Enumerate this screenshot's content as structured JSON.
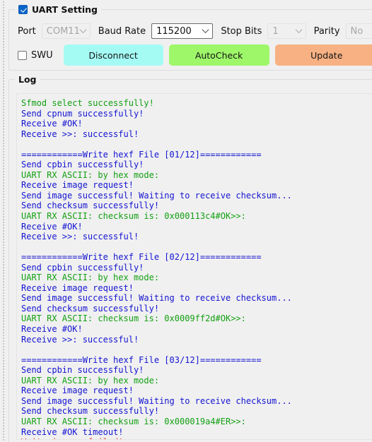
{
  "uart_group": {
    "title": "UART Setting",
    "enabled_checkbox": "checked",
    "port": {
      "label": "Port",
      "value": "COM11",
      "enabled": false
    },
    "baud_rate": {
      "label": "Baud Rate",
      "value": "115200",
      "enabled": true
    },
    "stop_bits": {
      "label": "Stop Bits",
      "value": "1",
      "enabled": false
    },
    "parity": {
      "label": "Parity",
      "value": "No",
      "enabled": false
    },
    "swu": {
      "label": "SWU",
      "checked": false
    },
    "buttons": [
      {
        "label": "Disconnect",
        "color": "#a4fbf4"
      },
      {
        "label": "AutoCheck",
        "color": "#9ef769"
      },
      {
        "label": "Update",
        "color": "#f7b183"
      }
    ]
  },
  "log_group": {
    "title": "Log",
    "lines": [
      {
        "text": "Sfmod select successfully!",
        "color": "green"
      },
      {
        "text": "Send cpnum successfully!",
        "color": "blue"
      },
      {
        "text": "Receive #OK!",
        "color": "blue"
      },
      {
        "text": "Receive >>: successful!",
        "color": "blue"
      },
      {
        "text": "",
        "color": "blank"
      },
      {
        "text": "============Write hexf File [01/12]============",
        "color": "blue"
      },
      {
        "text": "Send cpbin successfully!",
        "color": "blue"
      },
      {
        "text": "UART RX ASCII: by hex mode:",
        "color": "green"
      },
      {
        "text": "Receive image request!",
        "color": "blue"
      },
      {
        "text": "Send image successful! Waiting to receive checksum...",
        "color": "blue"
      },
      {
        "text": "Send checksum successfully!",
        "color": "blue"
      },
      {
        "text": "UART RX ASCII: checksum is: 0x000113c4#OK>>:",
        "color": "green"
      },
      {
        "text": "Receive #OK!",
        "color": "blue"
      },
      {
        "text": "Receive >>: successful!",
        "color": "blue"
      },
      {
        "text": "",
        "color": "blank"
      },
      {
        "text": "============Write hexf File [02/12]============",
        "color": "blue"
      },
      {
        "text": "Send cpbin successfully!",
        "color": "blue"
      },
      {
        "text": "UART RX ASCII: by hex mode:",
        "color": "green"
      },
      {
        "text": "Receive image request!",
        "color": "blue"
      },
      {
        "text": "Send image successful! Waiting to receive checksum...",
        "color": "blue"
      },
      {
        "text": "Send checksum successfully!",
        "color": "blue"
      },
      {
        "text": "UART RX ASCII: checksum is: 0x0009ff2d#OK>>:",
        "color": "green"
      },
      {
        "text": "Receive #OK!",
        "color": "blue"
      },
      {
        "text": "Receive >>: successful!",
        "color": "blue"
      },
      {
        "text": "",
        "color": "blank"
      },
      {
        "text": "============Write hexf File [03/12]============",
        "color": "blue"
      },
      {
        "text": "Send cpbin successfully!",
        "color": "blue"
      },
      {
        "text": "UART RX ASCII: by hex mode:",
        "color": "green"
      },
      {
        "text": "Receive image request!",
        "color": "blue"
      },
      {
        "text": "Send image successful! Waiting to receive checksum...",
        "color": "blue"
      },
      {
        "text": "Send checksum successfully!",
        "color": "blue"
      },
      {
        "text": "UART RX ASCII: checksum is: 0x000019a4#ER>>:",
        "color": "green"
      },
      {
        "text": "Receive #OK timeout!",
        "color": "blue"
      },
      {
        "text": "Write images failed!",
        "color": "red"
      }
    ]
  }
}
